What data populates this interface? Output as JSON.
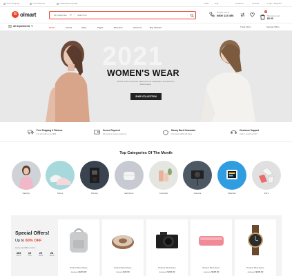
{
  "topbar": {
    "left": [
      "Free Shipping",
      "Free Returns",
      "Guaranteed Quality"
    ],
    "right": [
      "USD",
      "Eng",
      "Locations",
      "Contact",
      "Login / Register"
    ]
  },
  "logo": {
    "mark": "G",
    "text": "olmart"
  },
  "search": {
    "category": "All Categories",
    "placeholder": "Search for"
  },
  "hotline": {
    "label": "Hotline (24/7)",
    "number": "0800 123 456"
  },
  "cart": {
    "count": "0",
    "label": "Shopping cart",
    "value": "$0.00"
  },
  "nav": {
    "all_departments": "All Departments",
    "items": [
      "Home",
      "Vendor",
      "Shop",
      "Pages",
      "Elements",
      "About Us",
      "Buy Wolmart"
    ],
    "right": [
      "Track Order",
      "Special Offers"
    ]
  },
  "hero": {
    "year": "2021",
    "title": "WOMEN'S WEAR",
    "subtitle": "Sed ut unde omnis iste natus error sit voluptatem accusantium doloremque.",
    "button": "SHOP COLLECTION"
  },
  "features": [
    {
      "title": "Free Shipping & Returns",
      "sub": "For all orders over $99"
    },
    {
      "title": "Secure Payment",
      "sub": "We ensure secure payment"
    },
    {
      "title": "Money Back Guarantee",
      "sub": "Any back within 30 days"
    },
    {
      "title": "Customer Support",
      "sub": "Call or email us 24/7"
    }
  ],
  "categories_title": "Top Categories Of The Month",
  "categories": [
    "Fashion",
    "Shoes",
    "Kitchen",
    "Earphone",
    "Cosmetic",
    "Camera",
    "Watches",
    "Kid's"
  ],
  "offers": {
    "title": "Special Offers!",
    "discount_prefix": "Up to ",
    "discount_value": "60% OFF",
    "hurry": "Hurry up! Offer end in:",
    "countdown": [
      {
        "n": "463",
        "u": "DAYS"
      },
      {
        "n": "15",
        "u": "HRS"
      },
      {
        "n": "29",
        "u": "MINS"
      },
      {
        "n": "28",
        "u": "SECS"
      }
    ]
  },
  "products": [
    {
      "name": "Product Short Name",
      "old": "$279.00",
      "price": "$249.00"
    },
    {
      "name": "Product Short Name",
      "old": "$30.00",
      "price": "$20.00"
    },
    {
      "name": "Product Short Name",
      "old": "$254.00",
      "price": "$220.00"
    },
    {
      "name": "Product Short Name",
      "old": "$120.00",
      "price": "$105.00"
    },
    {
      "name": "Product Short Name",
      "old": "$250.00",
      "price": "$200.00"
    }
  ],
  "colors": {
    "accent": "#e8412c",
    "dark": "#222222"
  }
}
